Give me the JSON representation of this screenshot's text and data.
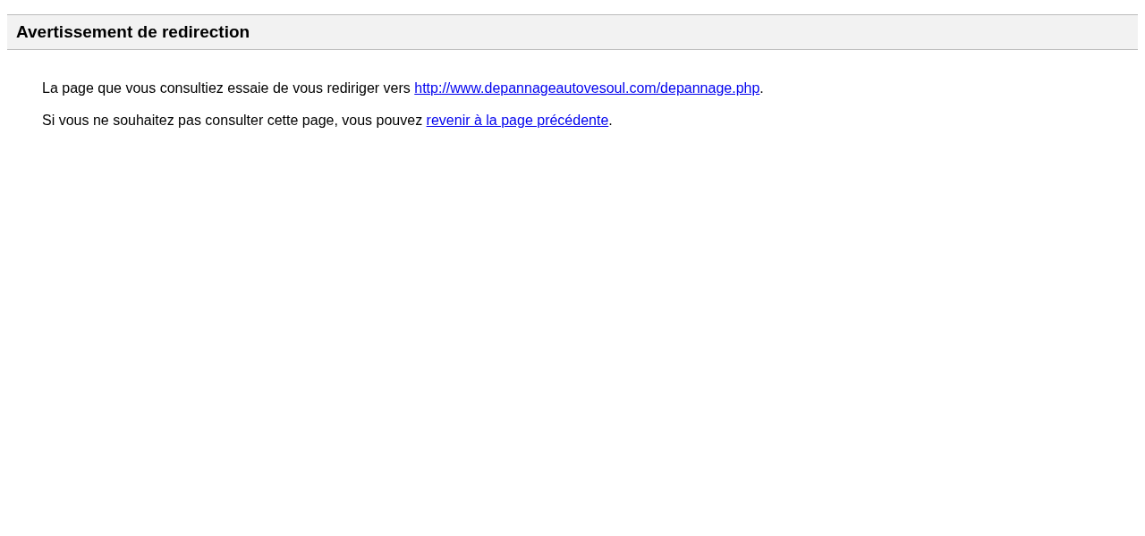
{
  "header": {
    "title": "Avertissement de redirection"
  },
  "paragraphs": [
    {
      "text": "La page que vous consultiez essaie de vous rediriger vers ",
      "link": "http://www.depannageautovesoul.com/depannage.php",
      "after": "."
    },
    {
      "text": "Si vous ne souhaitez pas consulter cette page, vous pouvez ",
      "link": "revenir à la page précédente",
      "after": "."
    }
  ]
}
